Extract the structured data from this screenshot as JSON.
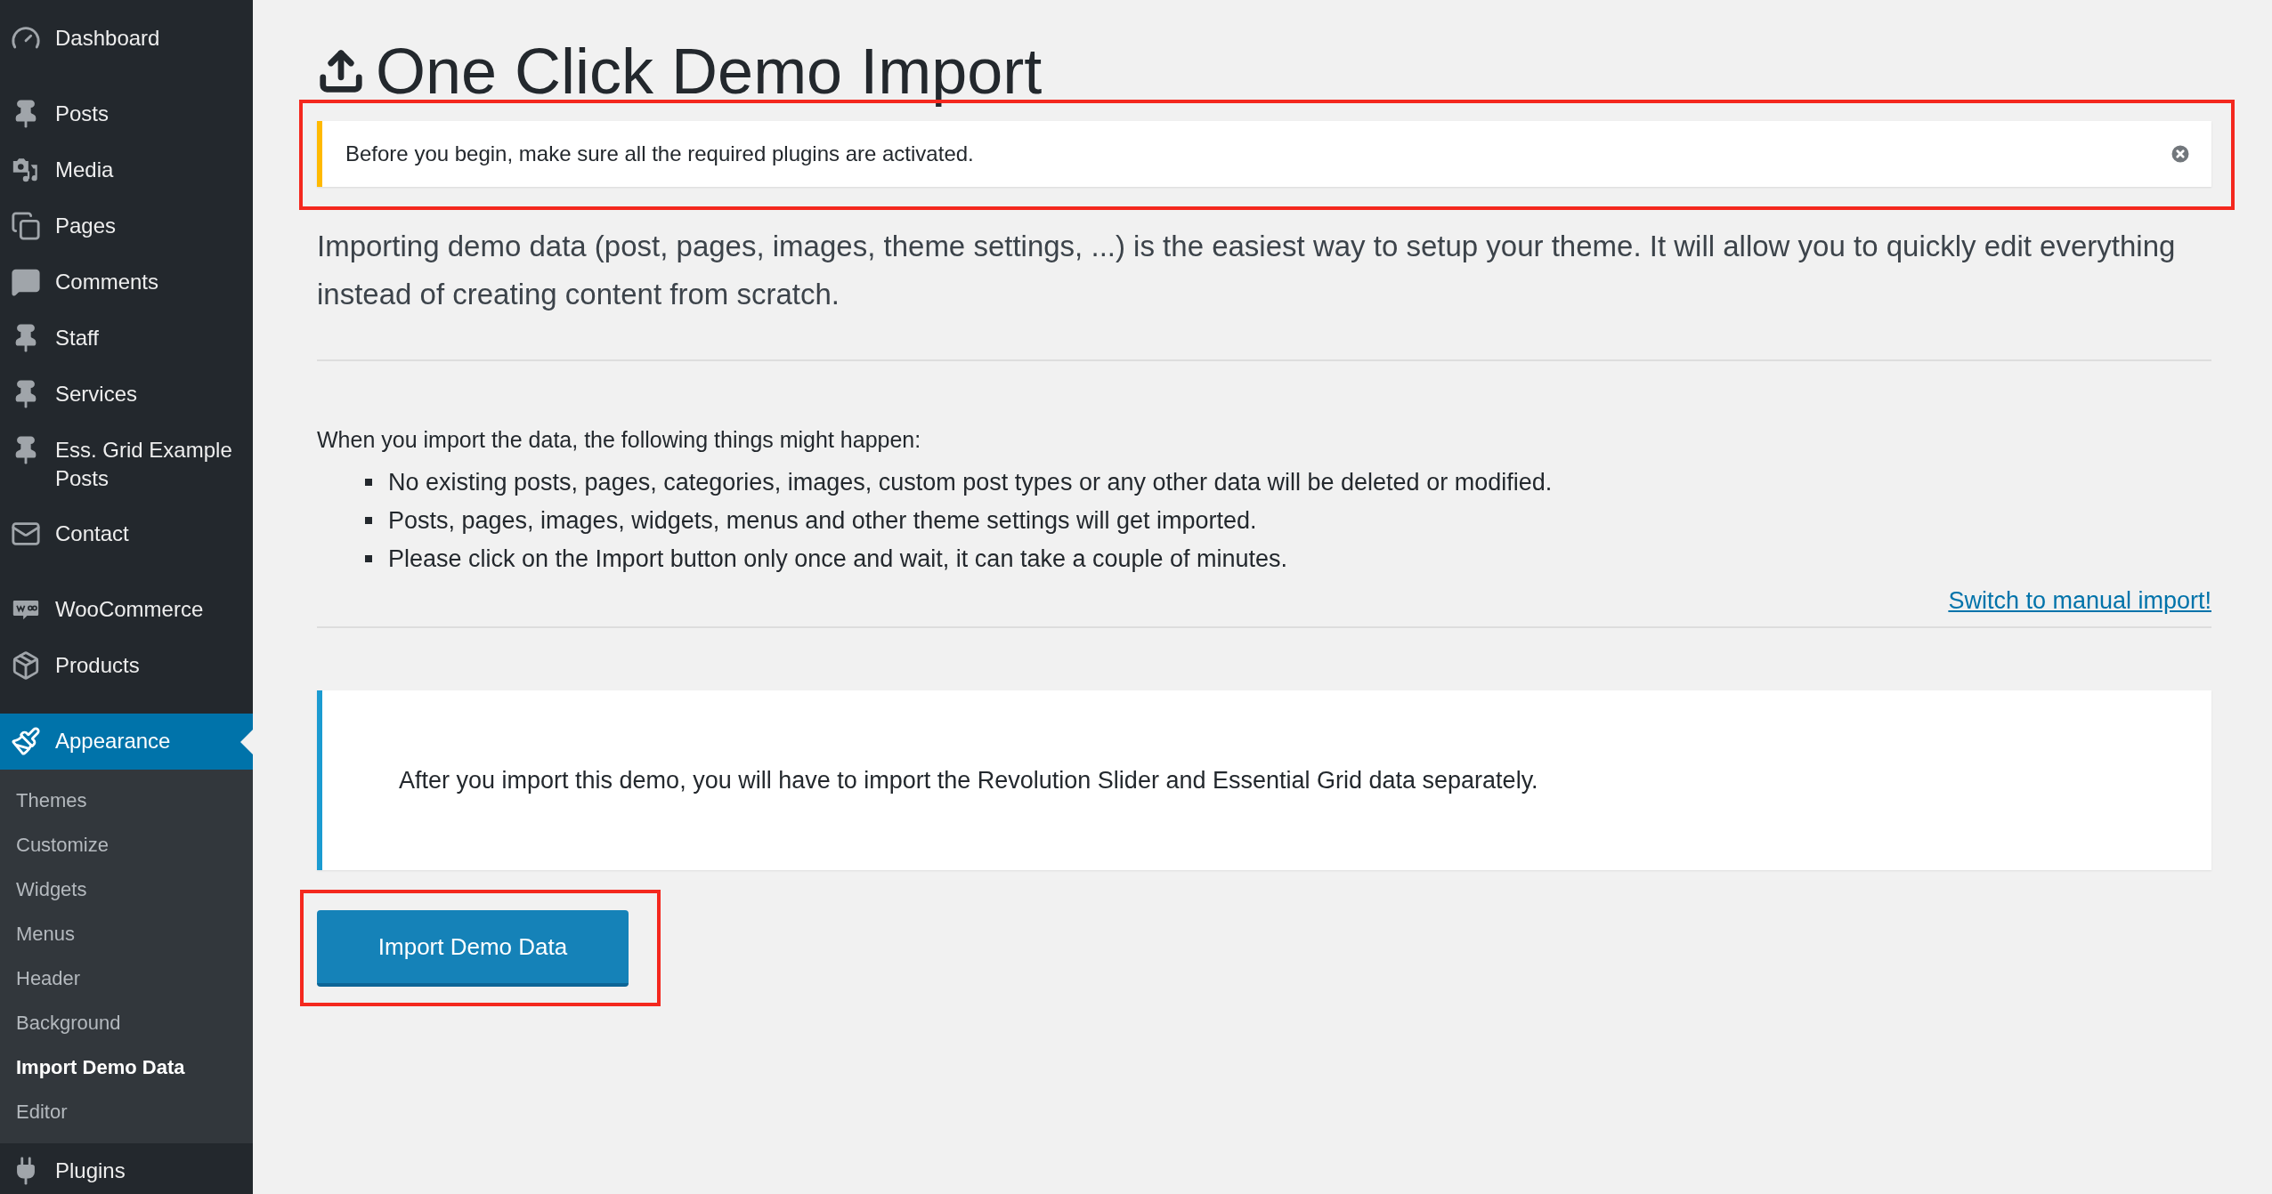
{
  "sidebar": {
    "groups": [
      [
        {
          "label": "Dashboard",
          "selected": false
        }
      ],
      [
        {
          "label": "Posts",
          "selected": false
        },
        {
          "label": "Media",
          "selected": false
        },
        {
          "label": "Pages",
          "selected": false
        },
        {
          "label": "Comments",
          "selected": false
        },
        {
          "label": "Staff",
          "selected": false
        },
        {
          "label": "Services",
          "selected": false
        },
        {
          "label": "Ess. Grid Example Posts",
          "selected": false
        },
        {
          "label": "Contact",
          "selected": false
        }
      ],
      [
        {
          "label": "WooCommerce",
          "selected": false
        },
        {
          "label": "Products",
          "selected": false
        }
      ],
      [
        {
          "label": "Appearance",
          "selected": true,
          "children": [
            {
              "label": "Themes",
              "selected": false
            },
            {
              "label": "Customize",
              "selected": false
            },
            {
              "label": "Widgets",
              "selected": false
            },
            {
              "label": "Menus",
              "selected": false
            },
            {
              "label": "Header",
              "selected": false
            },
            {
              "label": "Background",
              "selected": false
            },
            {
              "label": "Import Demo Data",
              "selected": true
            },
            {
              "label": "Editor",
              "selected": false
            }
          ]
        },
        {
          "label": "Plugins",
          "selected": false
        }
      ]
    ]
  },
  "page": {
    "title": "One Click Demo Import",
    "notice": {
      "text": "Before you begin, make sure all the required plugins are activated.",
      "highlighted": true
    },
    "intro": "Importing demo data (post, pages, images, theme settings, ...) is the easiest way to setup your theme. It will allow you to quickly edit everything instead of creating content from scratch.",
    "list_heading": "When you import the data, the following things might happen:",
    "list": [
      "No existing posts, pages, categories, images, custom post types or any other data will be deleted or modified.",
      "Posts, pages, images, widgets, menus and other theme settings will get imported.",
      "Please click on the Import button only once and wait, it can take a couple of minutes."
    ],
    "manual_link": "Switch to manual import!",
    "info_box": "After you import this demo, you will have to import the Revolution Slider and Essential Grid data separately.",
    "import_button": {
      "label": "Import Demo Data",
      "highlighted": true
    }
  }
}
